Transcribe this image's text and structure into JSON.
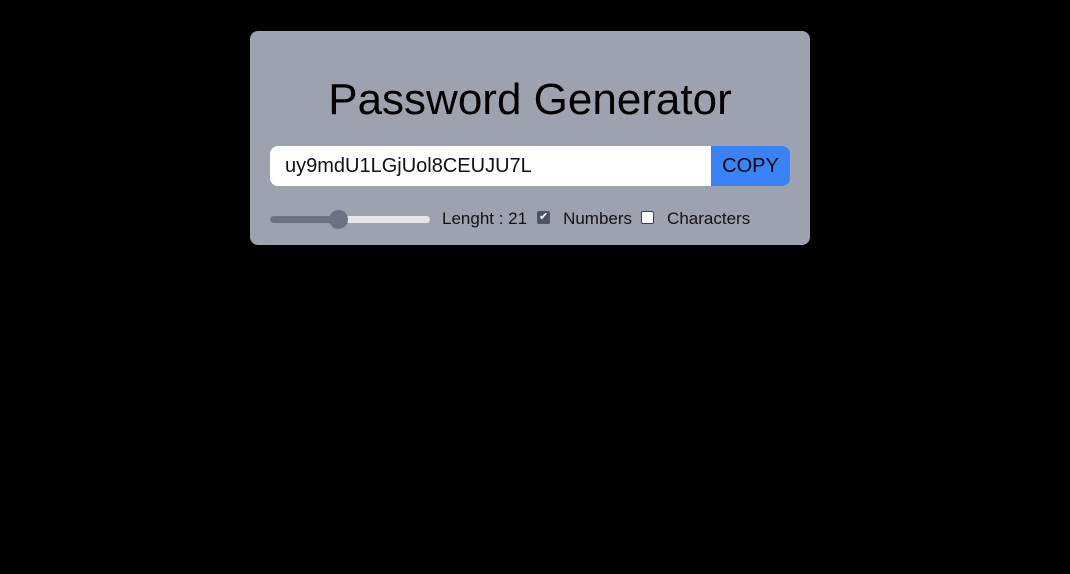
{
  "app": {
    "title": "Password Generator"
  },
  "password": {
    "value": "uy9mdU1LGjUol8CEUJU7L",
    "copy_label": "COPY"
  },
  "controls": {
    "length_label": "Lenght : 21",
    "length_value": 21,
    "length_min": 6,
    "length_max": 100,
    "numbers_label": "Numbers",
    "numbers_checked": true,
    "characters_label": "Characters",
    "characters_checked": false
  },
  "colors": {
    "background": "#000000",
    "card": "#9ca3af",
    "accent": "#3b82f6",
    "slider_fill": "#6b7280",
    "slider_track": "#e5e7eb"
  },
  "icons": {
    "checkmark": "check-icon"
  }
}
